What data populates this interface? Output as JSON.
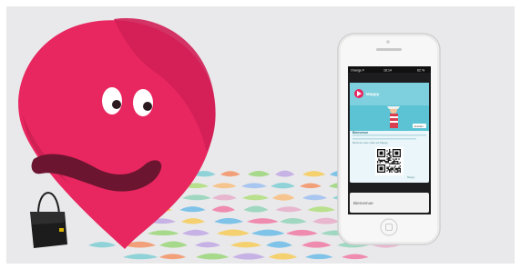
{
  "status_bar": {
    "carrier": "Orange F",
    "time": "16:14",
    "battery": "62 %"
  },
  "pass": {
    "brand": "Mappy",
    "badge": "Accéder",
    "welcome_heading": "Bienvenue",
    "welcome_text": "Merci de votre visite sur Mappy.",
    "qr_caption": "Mappy"
  },
  "notification": {
    "text": "Bienvenue"
  },
  "colors": {
    "mascot_pink": "#e8265f",
    "mascot_dark": "#b71b4a",
    "phone_white": "#f7f7f7",
    "pass_teal": "#5bc3d4"
  }
}
